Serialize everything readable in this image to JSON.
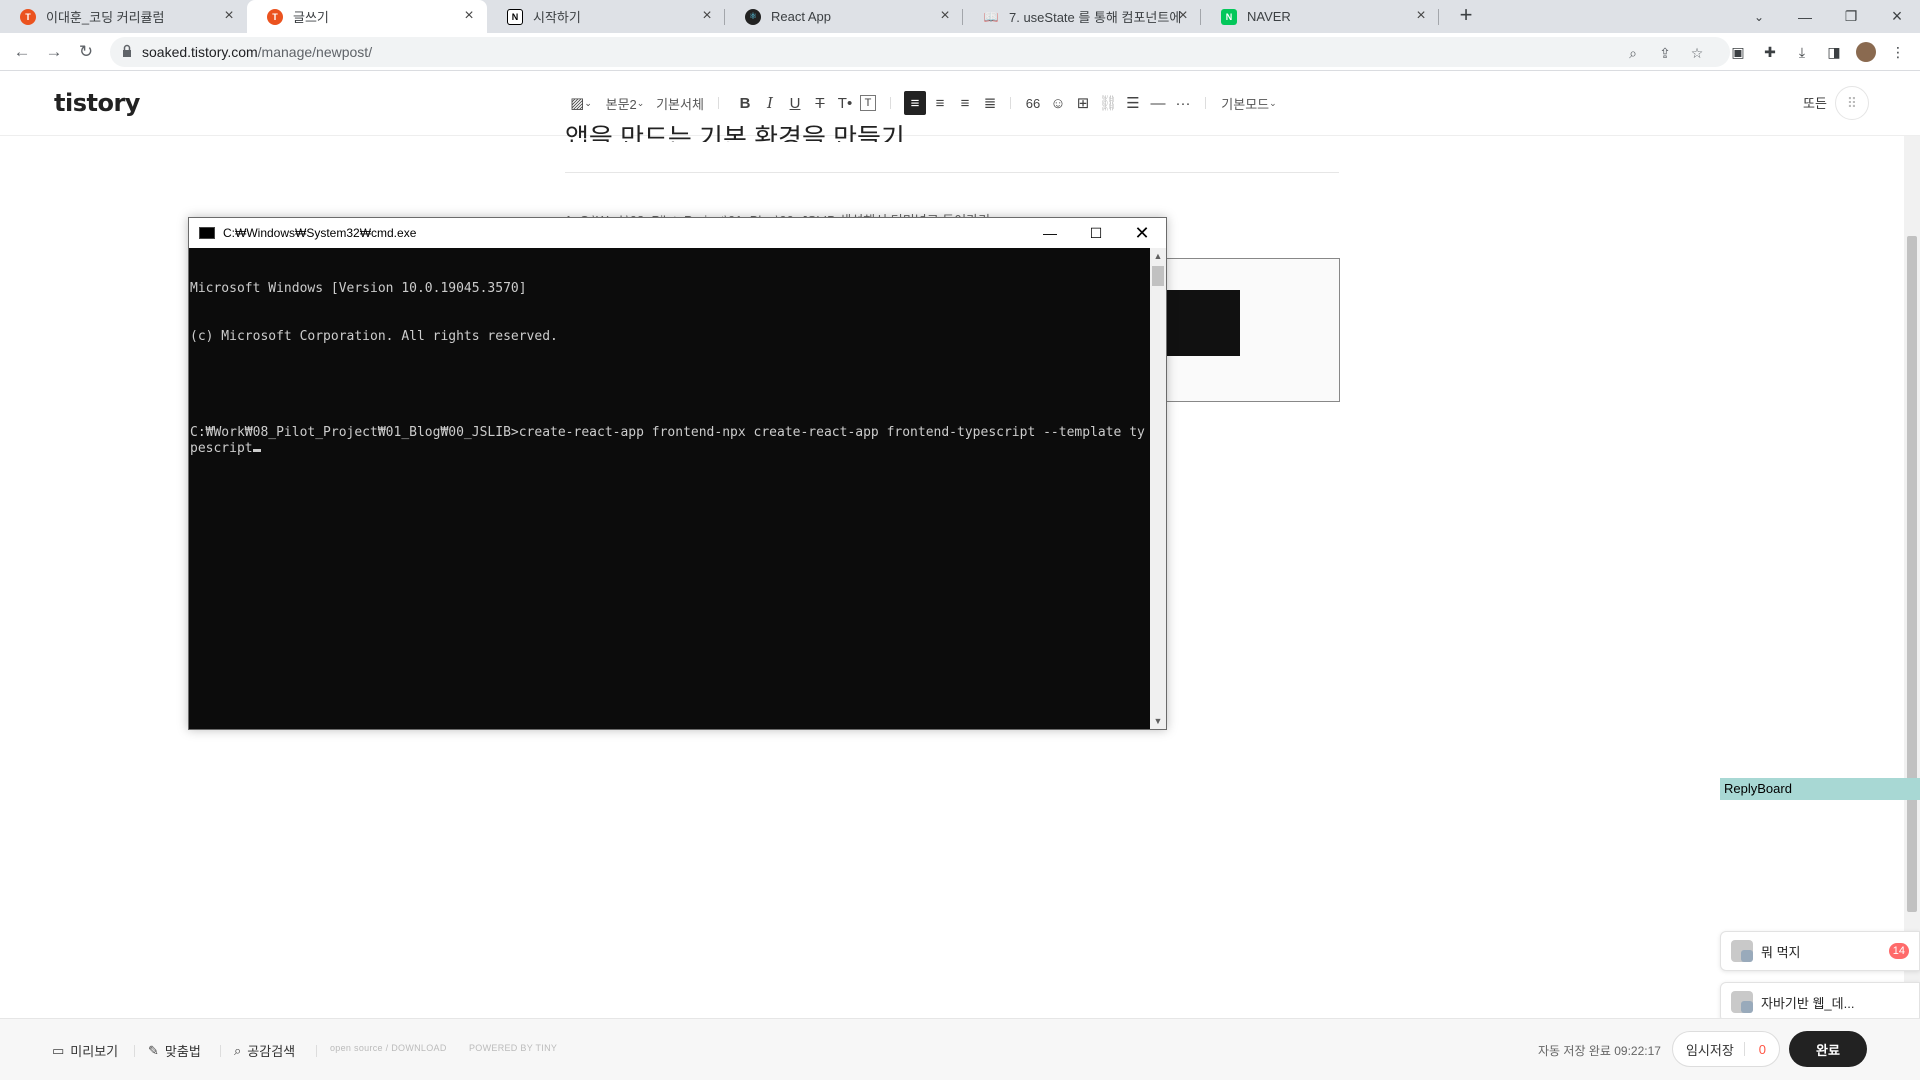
{
  "browser": {
    "tabs": [
      {
        "title": "이대훈_코딩 커리큘럼",
        "favicon": "T",
        "favicon_color": "#eb531f"
      },
      {
        "title": "글쓰기",
        "favicon": "T",
        "favicon_color": "#eb531f"
      },
      {
        "title": "시작하기",
        "favicon": "N",
        "favicon_color": "#000000"
      },
      {
        "title": "React App",
        "favicon": "⚛",
        "favicon_color": "#222222"
      },
      {
        "title": "7. useState 를 통해 컴포넌트에",
        "favicon": "📖",
        "favicon_color": "#444444"
      },
      {
        "title": "NAVER",
        "favicon": "N",
        "favicon_color": "#03c75a"
      }
    ],
    "url_host": "soaked.tistory.com",
    "url_path": "/manage/newpost/"
  },
  "editor": {
    "logo": "tistory",
    "toolbar": {
      "paragraph": "본문2",
      "font": "기본서체",
      "quote": "66",
      "more": "···",
      "mode": "기본모드",
      "dropdown_caret": "⌄"
    },
    "header_right": "또든",
    "post_title": "앱을 만드는 기본 환경을 만들기",
    "body_line1": "1. C:\\Work\\08_Pilot_Project\\01_Blog\\00_JSLIB 생성해서 터미널로 들어가기"
  },
  "cmd": {
    "title": "C:₩Windows₩System32₩cmd.exe",
    "lines": [
      "Microsoft Windows [Version 10.0.19045.3570]",
      "(c) Microsoft Corporation. All rights reserved.",
      "",
      "C:₩Work₩08_Pilot_Project₩01_Blog₩00_JSLIB>create-react-app frontend-npx create-react-app frontend-typescript --template typescript"
    ],
    "colors": {
      "background": "#0c0c0c",
      "text": "#cccccc"
    }
  },
  "widgets": {
    "replyboard": "ReplyBoard",
    "chats": [
      {
        "name": "뭐 먹지",
        "badge": "14"
      },
      {
        "name": "자바기반 웹_데..."
      }
    ]
  },
  "bottom": {
    "preview": "미리보기",
    "spellcheck": "맞춤법",
    "search": "공감검색",
    "tiny_left": "open source / DOWNLOAD",
    "tiny_right": "POWERED BY TINY",
    "autosave": "자동 저장 완료 09:22:17",
    "tempsave": "임시저장",
    "tempsave_count": "0",
    "done": "완료"
  }
}
